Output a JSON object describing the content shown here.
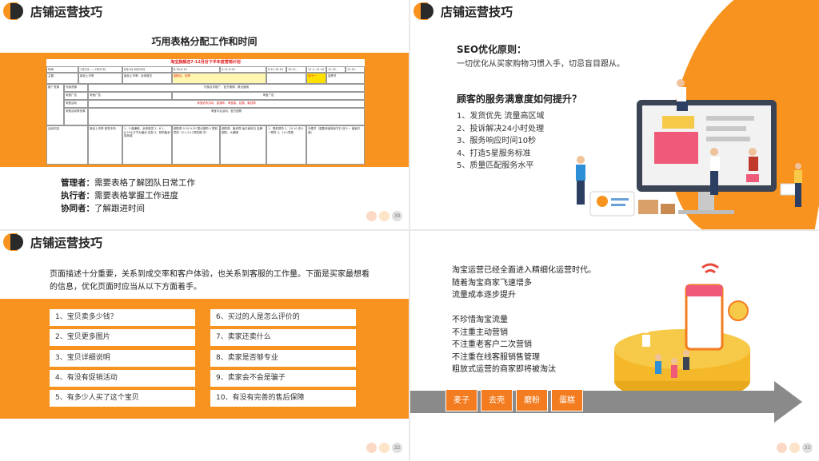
{
  "slides": [
    {
      "header": "店铺运营技巧",
      "subtitle": "巧用表格分配工作和时间",
      "table_title": "淘宝旗舰店7-12月份下半年度营销计划",
      "table_cells": {
        "time": "时间",
        "p1": "7月1日——7月31日",
        "p2": "8月1日-8月29日",
        "p3": "8.30-9.10",
        "p4": "9.11-9.20",
        "p5": "9.21-10.10",
        "p6": "10.11-10.31",
        "p7": "11.1--11.10",
        "p8": "11.12-11.20",
        "p9": "11.21-11.30",
        "theme": "主题",
        "th1": "新品上市季",
        "th2": "新品上市季：全球首发",
        "th3": "团购月、旺季",
        "th4": "双十一",
        "th5": "感恩节",
        "promo": "推广资源",
        "ext": "外部资源",
        "ext_v": "外部合作推广，官方微博、联合营销",
        "tb_ad": "淘宝广告",
        "tb_ad_v": "淘宝广告",
        "tb_ad_v2": "淘宝广告",
        "tb_act": "淘宝活动",
        "tb_act_v": "淘宝站内活动，直通车、淘宝客、钻展、聚划算",
        "tb_in": "淘宝活动等资源",
        "tb_in_v": "淘宝平台活动，官方团购",
        "content": "活动内容",
        "c1": "新品上市季 首发专场",
        "c2": "1、1.做爆款、全球首发 2、8.1-8.29七夕节为最优 定制 3、预热聚划算商城",
        "c3": "团购类 9.10-9.20 整点团购 4 提前预热（9.1-9.12预热期 中）",
        "c4": "团购类：聚划算 每日疯抢日 金牌团购，大牌团",
        "c5": "1、提前预热 2、10.10 双十一预热 3、10.1零售",
        "c6": "光棍节（重要淘宝电商节日 双十一 营销方案）"
      },
      "roles": [
        {
          "label": "管理者：",
          "text": "需要表格了解团队日常工作"
        },
        {
          "label": "执行者：",
          "text": "需要表格掌握工作进度"
        },
        {
          "label": "协同者：",
          "text": "了解跟进时间"
        }
      ],
      "page_number": "30"
    },
    {
      "header": "店铺运营技巧",
      "seo_title": "SEO优化原则：",
      "seo_text": "一切优化从买家购物习惯入手，切忌盲目跟从。",
      "question": "顾客的服务满意度如何提升？",
      "items": [
        "1、发货优先 流量高区域",
        "2、投诉解决24小时处理",
        "3、服务响应时间10秒",
        "4、打造5星服务标准",
        "5、质量匹配服务水平"
      ]
    },
    {
      "header": "店铺运营技巧",
      "intro": "页面描述十分重要，关系到成交率和客户体验，也关系到客服的工作量。下面是买家最想看的信息，优化页面时应当从以下方面着手。",
      "left_items": [
        "1、宝贝卖多少钱？",
        "2、宝贝更多图片",
        "3、宝贝详细说明",
        "4、有没有促销活动",
        "5、有多少人买了这个宝贝"
      ],
      "right_items": [
        "6、买过的人是怎么评价的",
        "7、卖家还卖什么",
        "8、卖家是否够专业",
        "9、卖家会不会是骗子",
        "10、有没有完善的售后保障"
      ],
      "page_number": "32"
    },
    {
      "lines": [
        "淘宝运营已经全面进入精细化运营时代。",
        "随着淘宝商家飞速增多",
        "流量成本逐步提升",
        "",
        "不珍惜淘宝流量",
        "不注重主动营销",
        "不注重老客户二次营销",
        "不注重在线客服销售管理",
        "粗放式运营的商家即将被淘汰"
      ],
      "tags": [
        "麦子",
        "去壳",
        "磨粉",
        "蛋糕"
      ],
      "page_number": "33"
    }
  ],
  "colors": {
    "accent": "#f7931e",
    "dark": "#2a2a2a",
    "tag": "#f47c20",
    "arrow": "#8a8a8a"
  }
}
